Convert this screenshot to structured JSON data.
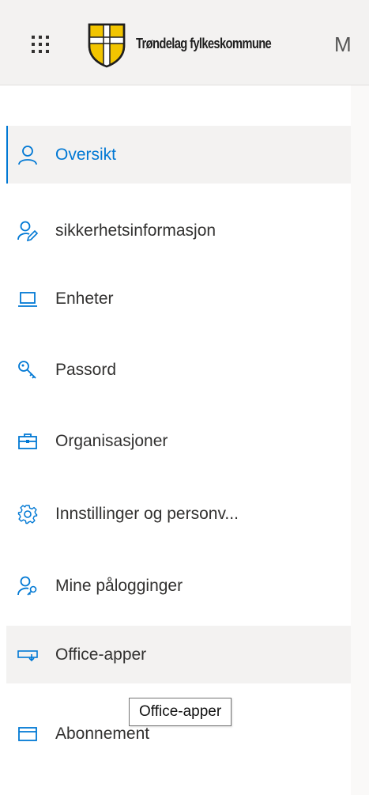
{
  "header": {
    "org_name": "Trøndelag fylkeskommune",
    "cut_off_text": "M"
  },
  "nav": {
    "items": [
      {
        "label": "Oversikt",
        "icon": "person-icon",
        "state": "selected"
      },
      {
        "label": "sikkerhetsinformasjon",
        "icon": "person-edit-icon"
      },
      {
        "label": "Enheter",
        "icon": "laptop-icon"
      },
      {
        "label": "Passord",
        "icon": "key-icon"
      },
      {
        "label": "Organisasjoner",
        "icon": "briefcase-icon"
      },
      {
        "label": "Innstillinger og personv...",
        "icon": "gear-icon"
      },
      {
        "label": "Mine pålogginger",
        "icon": "person-key-icon"
      },
      {
        "label": "Office-apper",
        "icon": "office-apps-icon",
        "state": "hovered"
      },
      {
        "label": "Abonnement",
        "icon": "credit-card-icon"
      }
    ]
  },
  "tooltip": {
    "text": "Office-apper"
  },
  "colors": {
    "accent": "#0078d4",
    "topbar_bg": "#f3f2f1",
    "selected_bg": "#f3f2f1",
    "text": "#323130"
  }
}
